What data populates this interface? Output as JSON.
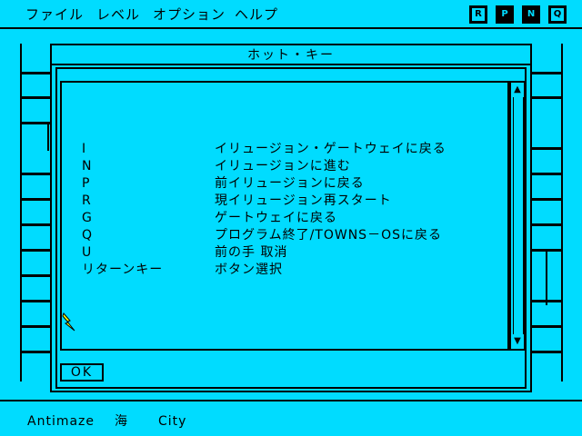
{
  "menu": {
    "items": [
      "ファイル",
      "レベル",
      "オプション",
      "ヘルプ"
    ]
  },
  "toolbar": {
    "buttons": [
      {
        "label": "R",
        "icon": "restart-icon"
      },
      {
        "label": "P",
        "icon": "previous-icon"
      },
      {
        "label": "N",
        "icon": "next-icon"
      },
      {
        "label": "Q",
        "icon": "quit-icon"
      }
    ]
  },
  "dialog": {
    "title": "ホット・キー",
    "hotkeys": [
      {
        "key": "I",
        "desc": "イリュージョン・ゲートウェイに戻る"
      },
      {
        "key": "N",
        "desc": "イリュージョンに進む"
      },
      {
        "key": "P",
        "desc": "前イリュージョンに戻る"
      },
      {
        "key": "R",
        "desc": "現イリュージョン再スタート"
      },
      {
        "key": "G",
        "desc": "ゲートウェイに戻る"
      },
      {
        "key": "Q",
        "desc": "プログラム終了/TOWNS－OSに戻る"
      },
      {
        "key": "U",
        "desc": "前の手 取消"
      },
      {
        "key": "リターンキー",
        "desc": "ボタン選択"
      }
    ],
    "ok_label": "OK"
  },
  "status": {
    "items": [
      "Antimaze",
      "海",
      "City"
    ]
  },
  "colors": {
    "background": "#00dcff",
    "ink": "#000000"
  }
}
